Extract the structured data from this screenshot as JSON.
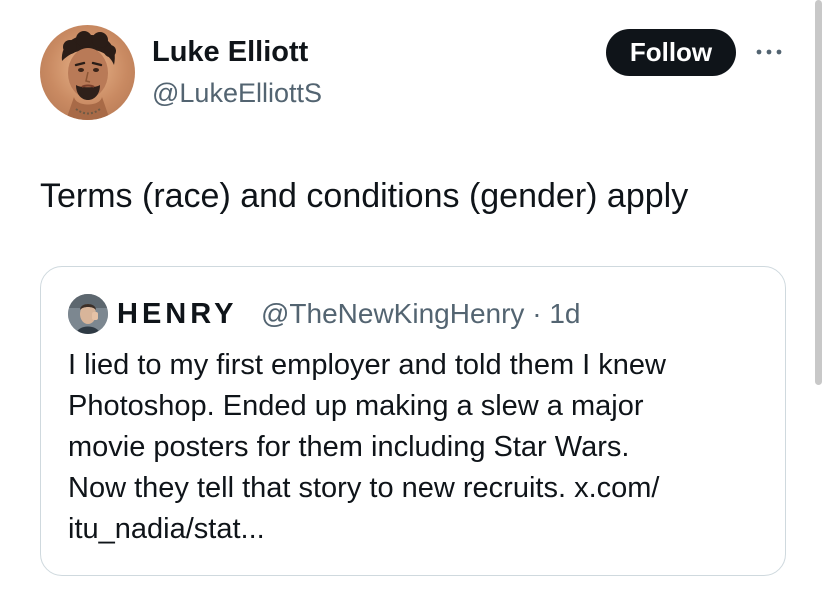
{
  "author": {
    "name": "Luke Elliott",
    "handle": "@LukeElliottS",
    "avatar": "profile-photo"
  },
  "follow_button": {
    "label": "Follow"
  },
  "more_menu": {
    "icon": "more-horizontal-icon"
  },
  "tweet": {
    "text": "Terms (race) and conditions (gender) apply"
  },
  "quoted_tweet": {
    "author_name": "HENRY",
    "author_handle": "@TheNewKingHenry",
    "separator": "·",
    "time_ago": "1d",
    "body_lines": [
      "I lied to my first employer and told them I knew",
      "Photoshop. Ended up making a slew a major",
      "movie posters for them including Star Wars.",
      "Now they tell that story to new recruits. x.com/",
      "itu_nadia/stat..."
    ]
  },
  "colors": {
    "text_primary": "#0f1419",
    "text_secondary": "#536471",
    "button_bg": "#0f1419",
    "button_text": "#ffffff",
    "card_border": "#cfd9de"
  }
}
